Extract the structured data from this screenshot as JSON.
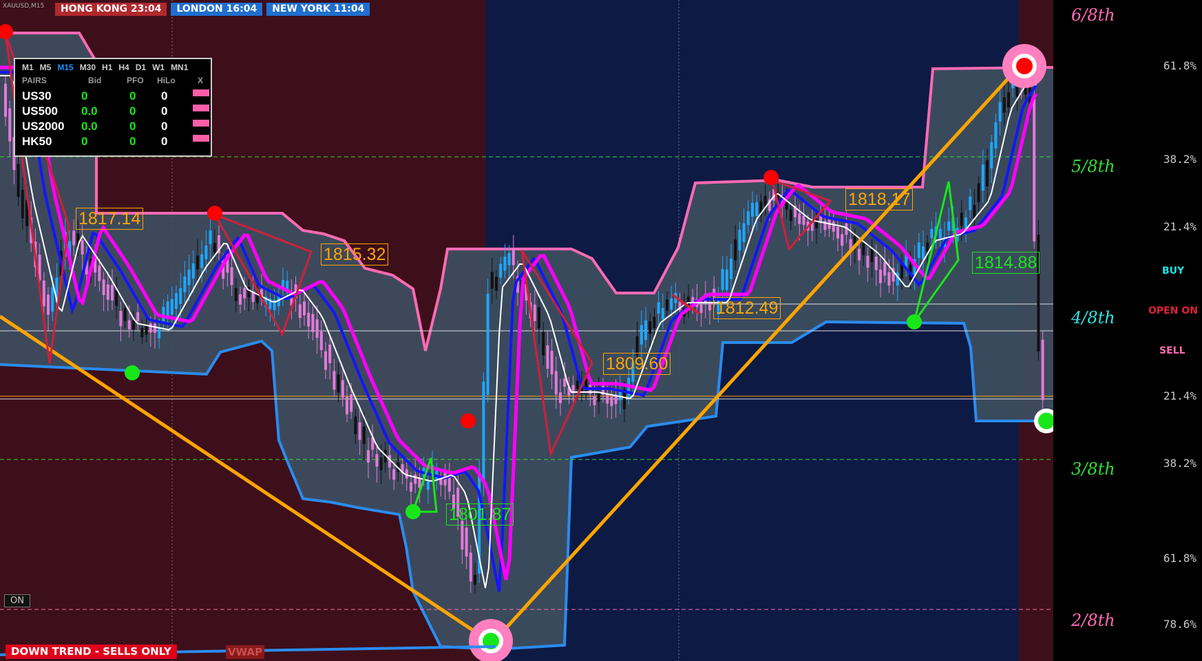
{
  "symbol": "XAUUSD,M15",
  "sessions": [
    {
      "label": "HONG KONG 23:04",
      "color": "#c0392b"
    },
    {
      "label": "LONDON  16:04",
      "color": "#1f6fd0"
    },
    {
      "label": "NEW YORK 11:04",
      "color": "#1f6fd0"
    }
  ],
  "dashboard": {
    "timeframes": [
      "M1",
      "M5",
      "M15",
      "M30",
      "H1",
      "H4",
      "D1",
      "W1",
      "MN1"
    ],
    "active_timeframe": "M15",
    "headers": {
      "pairs": "PAIRS",
      "bid": "Bid",
      "pfo": "PFO",
      "hilo": "HiLo",
      "x": "X"
    },
    "rows": [
      {
        "pair": "US30",
        "bid": "0",
        "pfo": "0",
        "hilo": "0"
      },
      {
        "pair": "US500",
        "bid": "0.0",
        "pfo": "0",
        "hilo": "0"
      },
      {
        "pair": "US2000",
        "bid": "0.0",
        "pfo": "0",
        "hilo": "0"
      },
      {
        "pair": "HK50",
        "bid": "0",
        "pfo": "0",
        "hilo": "0"
      }
    ]
  },
  "price_labels": [
    {
      "text": "1817.14",
      "color": "orange"
    },
    {
      "text": "1815.32",
      "color": "orange"
    },
    {
      "text": "1809.60",
      "color": "orange"
    },
    {
      "text": "1812.49",
      "color": "orange"
    },
    {
      "text": "1818.17",
      "color": "orange"
    },
    {
      "text": "1814.88",
      "color": "green"
    },
    {
      "text": "1801.87",
      "color": "green"
    }
  ],
  "octaves": [
    {
      "label": "6/8th",
      "color": "#ff6ab4"
    },
    {
      "label": "5/8th",
      "color": "#33dd33"
    },
    {
      "label": "4/8th",
      "color": "#33e0e0"
    },
    {
      "label": "3/8th",
      "color": "#33dd33"
    },
    {
      "label": "2/8th",
      "color": "#ff6ab4"
    }
  ],
  "fib_levels": [
    "61.8%",
    "38.2%",
    "21.4%",
    "21.4%",
    "38.2%",
    "61.8%",
    "78.6%"
  ],
  "signals": {
    "buy": "BUY",
    "open": "OPEN ON",
    "sell": "SELL"
  },
  "trend_banner": "DOWN TREND - SELLS ONLY",
  "vwap_label": "VWAP",
  "on_button": "ON",
  "colors": {
    "up_candle": "#1ea7ff",
    "down_candle": "#e27ad8",
    "neutral_candle": "#111111",
    "band_fill": "#3d4d5f",
    "upper_band": "#ff6ab4",
    "lower_band": "#2a8cf0",
    "ma_magenta": "#ff00ff",
    "ma_blue": "#1515ff",
    "ma_white": "#ffffff",
    "trend_line": "#ffa500",
    "bg_asia": "#3d0f1a",
    "bg_ny": "#0d1a44"
  }
}
